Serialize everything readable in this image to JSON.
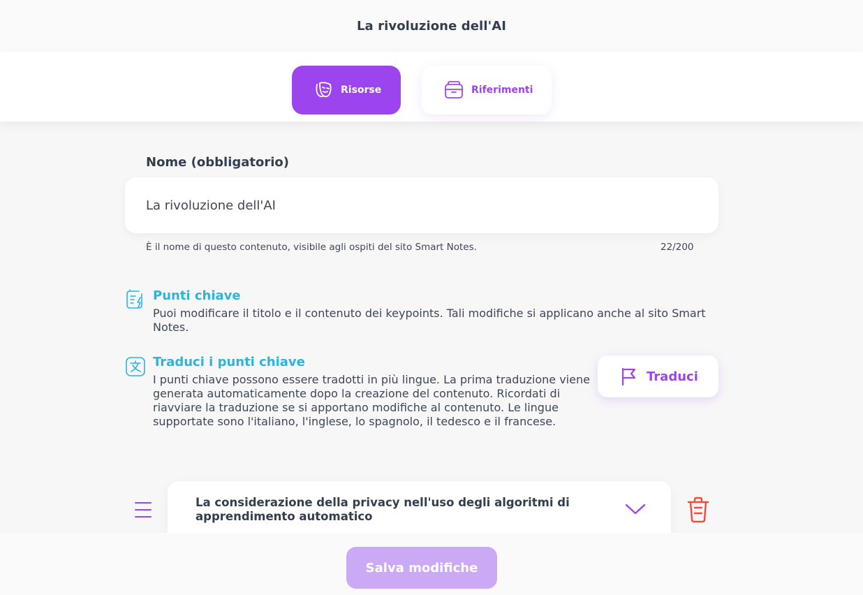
{
  "header": {
    "title": "La rivoluzione dell'AI"
  },
  "tabs": [
    {
      "label": "Risorse",
      "icon": "theater-masks-icon",
      "active": true
    },
    {
      "label": "Riferimenti",
      "icon": "folder-icon",
      "active": false
    }
  ],
  "name_field": {
    "label": "Nome (obbligatorio)",
    "value": "La rivoluzione dell'AI",
    "hint": "È il nome di questo contenuto, visibile agli ospiti del sito Smart Notes.",
    "counter": "22/200"
  },
  "keypoints_section": {
    "icon": "document-lightning-icon",
    "title": "Punti chiave",
    "description": "Puoi modificare il titolo e il contenuto dei keypoints. Tali modifiche si applicano anche al sito Smart Notes."
  },
  "translate_section": {
    "icon": "translate-icon",
    "title": "Traduci i punti chiave",
    "description": "I punti chiave possono essere tradotti in più lingue. La prima traduzione viene generata automaticamente dopo la creazione del contenuto. Ricordati di riavviare la traduzione se si apportano modifiche al contenuto. Le lingue supportate sono l'italiano, l'inglese, lo spagnolo, il tedesco e il francese.",
    "button_label": "Traduci",
    "button_icon": "flag-icon"
  },
  "keypoint_items": [
    {
      "title": "La considerazione della privacy nell'uso degli algoritmi di apprendimento automatico"
    }
  ],
  "footer": {
    "save_label": "Salva modifiche"
  },
  "colors": {
    "accent": "#9c45ee",
    "accent_disabled": "#cba9f4",
    "section_title": "#2fb3d9",
    "danger": "#ef4c3c"
  }
}
